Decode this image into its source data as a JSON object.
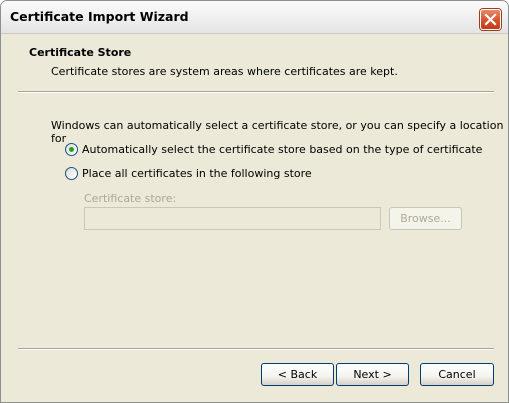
{
  "window": {
    "title": "Certificate Import Wizard"
  },
  "header": {
    "title": "Certificate Store",
    "subtitle": "Certificate stores are system areas where certificates are kept."
  },
  "body": {
    "intro": "Windows can automatically select a certificate store, or you can specify a location for",
    "options": [
      {
        "label": "Automatically select the certificate store based on the type of certificate",
        "selected": true
      },
      {
        "label": "Place all certificates in the following store",
        "selected": false
      }
    ],
    "store_field": {
      "label": "Certificate store:",
      "value": "",
      "browse_label": "Browse..."
    }
  },
  "buttons": {
    "back": "< Back",
    "next": "Next >",
    "cancel": "Cancel"
  },
  "colors": {
    "dialog_bg": "#ece9d8",
    "radio_dot": "#21a121",
    "close_button": "#d4532d"
  }
}
